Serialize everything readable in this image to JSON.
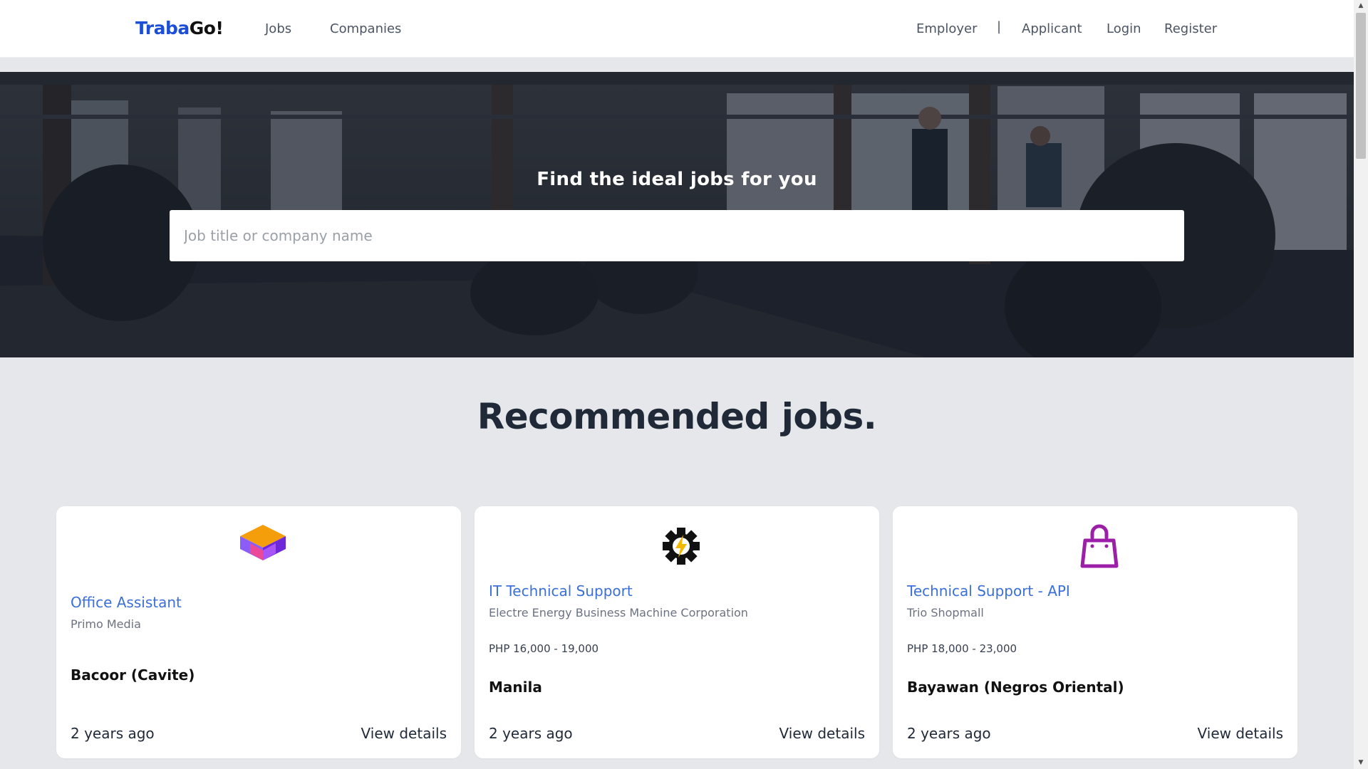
{
  "navbar": {
    "logo_part1": "Traba",
    "logo_part2": "Go!",
    "links_left": [
      "Jobs",
      "Companies"
    ],
    "links_right": [
      "Employer",
      "Applicant",
      "Login",
      "Register"
    ],
    "separator": "|"
  },
  "hero": {
    "title": "Find the ideal jobs for you",
    "search_placeholder": "Job title or company name"
  },
  "section": {
    "title": "Recommended jobs."
  },
  "jobs": [
    {
      "title": "Office Assistant",
      "company": "Primo Media",
      "salary": "",
      "location": "Bacoor (Cavite)",
      "posted": "2 years ago",
      "action": "View details",
      "logo_icon": "cube-logo-icon"
    },
    {
      "title": "IT Technical Support",
      "company": "Electre Energy Business Machine Corporation",
      "salary": "PHP 16,000 - 19,000",
      "location": "Manila",
      "posted": "2 years ago",
      "action": "View details",
      "logo_icon": "gear-bolt-logo-icon"
    },
    {
      "title": "Technical Support - API",
      "company": "Trio Shopmall",
      "salary": "PHP 18,000 - 23,000",
      "location": "Bayawan (Negros Oriental)",
      "posted": "2 years ago",
      "action": "View details",
      "logo_icon": "shopping-bag-logo-icon"
    }
  ],
  "colors": {
    "brand_blue": "#1d4ed8",
    "job_title_blue": "#3b6fd9",
    "page_bg": "#e5e7eb"
  }
}
